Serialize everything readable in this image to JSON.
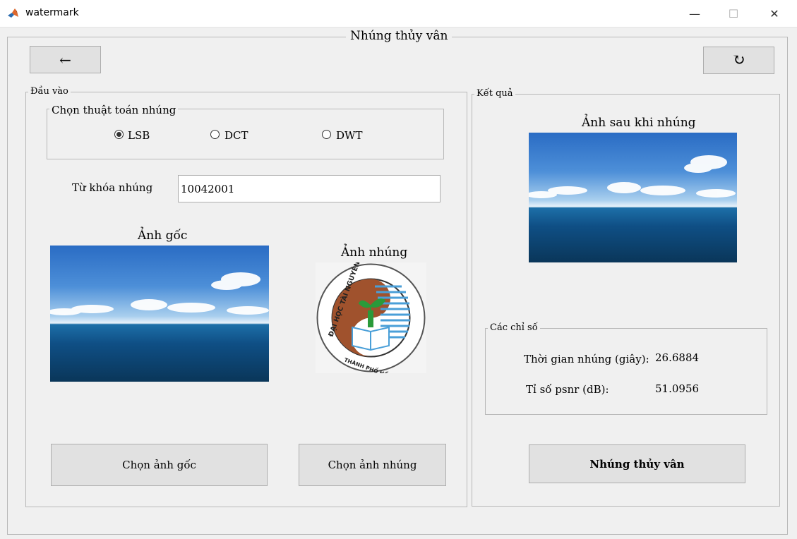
{
  "window": {
    "title": "watermark",
    "controls": {
      "minimize": "—",
      "maximize": "☐",
      "close": "✕"
    }
  },
  "main": {
    "title": "Nhúng thủy vân",
    "back_label": "←",
    "refresh_label": "↻"
  },
  "input_panel": {
    "legend": "Đầu vào",
    "algo_group": {
      "legend": "Chọn thuật toán nhúng",
      "options": [
        "LSB",
        "DCT",
        "DWT"
      ],
      "selected": "LSB"
    },
    "key_label": "Từ khóa nhúng",
    "key_value": "10042001",
    "original_label": "Ảnh gốc",
    "watermark_label": "Ảnh nhúng",
    "logo_text": {
      "top": "ĐẠI HỌC TÀI NGUYÊN VÀ MÔI TRƯỜNG",
      "bottom": "THÀNH PHỐ HỒ CHÍ MINH"
    },
    "choose_original": "Chọn ảnh gốc",
    "choose_watermark": "Chọn ảnh nhúng"
  },
  "result_panel": {
    "legend": "Kết quả",
    "result_label": "Ảnh sau khi nhúng",
    "metrics": {
      "legend": "Các chỉ số",
      "time_label": "Thời gian nhúng (giây):",
      "time_value": "26.6884",
      "psnr_label": "Tỉ số psnr (dB):",
      "psnr_value": "51.0956"
    },
    "embed_button": "Nhúng thủy vân"
  }
}
